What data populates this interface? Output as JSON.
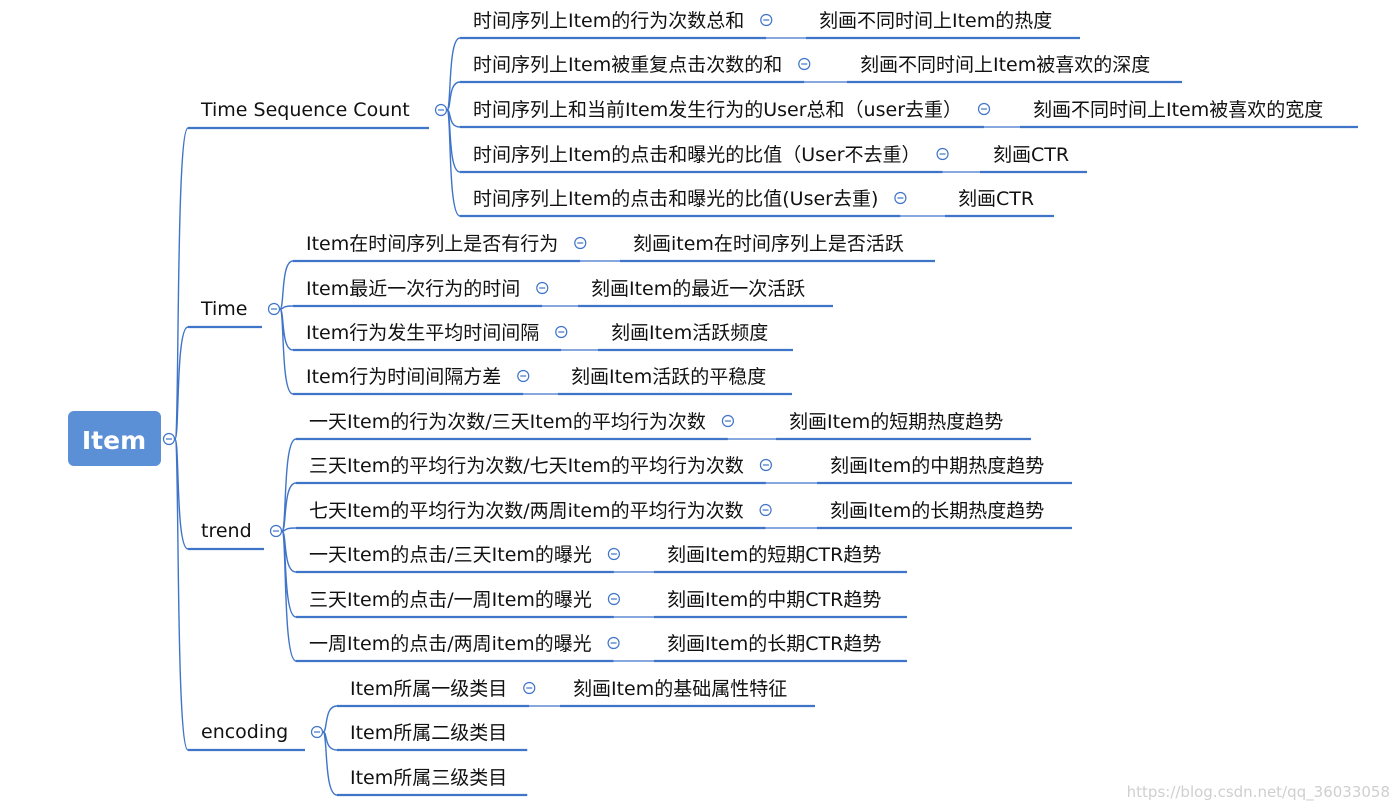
{
  "root": "Item",
  "colors": {
    "line": "#3f74c9",
    "root_fill": "#5b8fd6",
    "collapse": "#3f74c9"
  },
  "branches": [
    {
      "label": "Time Sequence Count",
      "children": [
        {
          "label": "时间序列上Item的行为次数总和",
          "note": "刻画不同时间上Item的热度"
        },
        {
          "label": "时间序列上Item被重复点击次数的和",
          "note": "刻画不同时间上Item被喜欢的深度"
        },
        {
          "label": "时间序列上和当前Item发生行为的User总和（user去重）",
          "note": "刻画不同时间上Item被喜欢的宽度"
        },
        {
          "label": "时间序列上Item的点击和曝光的比值（User不去重）",
          "note": "刻画CTR"
        },
        {
          "label": "时间序列上Item的点击和曝光的比值(User去重)",
          "note": "刻画CTR"
        }
      ]
    },
    {
      "label": "Time",
      "children": [
        {
          "label": "Item在时间序列上是否有行为",
          "note": "刻画item在时间序列上是否活跃"
        },
        {
          "label": "Item最近一次行为的时间",
          "note": "刻画Item的最近一次活跃"
        },
        {
          "label": "Item行为发生平均时间间隔",
          "note": "刻画Item活跃频度"
        },
        {
          "label": "Item行为时间间隔方差",
          "note": "刻画Item活跃的平稳度"
        }
      ]
    },
    {
      "label": "trend",
      "children": [
        {
          "label": "一天Item的行为次数/三天Item的平均行为次数",
          "note": "刻画Item的短期热度趋势"
        },
        {
          "label": "三天Item的平均行为次数/七天Item的平均行为次数",
          "note": "刻画Item的中期热度趋势"
        },
        {
          "label": "七天Item的平均行为次数/两周item的平均行为次数",
          "note": "刻画Item的长期热度趋势"
        },
        {
          "label": "一天Item的点击/三天Item的曝光",
          "note": "刻画Item的短期CTR趋势"
        },
        {
          "label": "三天Item的点击/一周Item的曝光",
          "note": "刻画Item的中期CTR趋势"
        },
        {
          "label": "一周Item的点击/两周item的曝光",
          "note": "刻画Item的长期CTR趋势"
        }
      ]
    },
    {
      "label": "encoding",
      "children": [
        {
          "label": "Item所属一级类目",
          "note": "刻画Item的基础属性特征"
        },
        {
          "label": "Item所属二级类目"
        },
        {
          "label": "Item所属三级类目"
        }
      ]
    }
  ],
  "watermark": "https://blog.csdn.net/qq_36033058"
}
